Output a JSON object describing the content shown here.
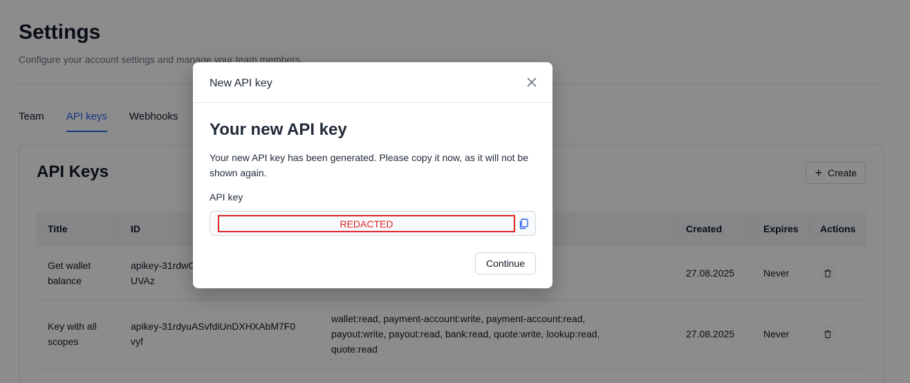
{
  "page": {
    "title": "Settings",
    "subtitle": "Configure your account settings and manage your team members."
  },
  "tabs": [
    {
      "label": "Team",
      "active": false
    },
    {
      "label": "API keys",
      "active": true
    },
    {
      "label": "Webhooks",
      "active": false
    }
  ],
  "card": {
    "title": "API Keys",
    "create_label": "Create"
  },
  "table": {
    "headers": {
      "title": "Title",
      "id": "ID",
      "created": "Created",
      "expires": "Expires",
      "actions": "Actions"
    },
    "rows": [
      {
        "title": "Get wallet balance",
        "id": "apikey-31rdwCUVAz",
        "scopes": "",
        "created": "27.08.2025",
        "expires": "Never"
      },
      {
        "title": "Key with all scopes",
        "id": "apikey-31rdyuASvfdiUnDXHXAbM7F0vyf",
        "scopes": "wallet:read, payment-account:write, payment-account:read, payout:write, payout:read, bank:read, quote:write, lookup:read, quote:read",
        "created": "27.08.2025",
        "expires": "Never"
      }
    ]
  },
  "modal": {
    "title": "New API key",
    "heading": "Your new API key",
    "description": "Your new API key has been generated. Please copy it now, as it will not be shown again.",
    "field_label": "API key",
    "key_value": "REDACTED",
    "continue_label": "Continue"
  },
  "colors": {
    "accent": "#2563eb",
    "redacted": "#dc2626"
  }
}
